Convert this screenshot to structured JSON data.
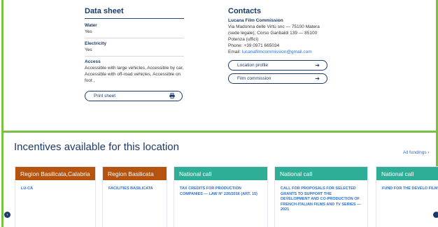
{
  "datasheet": {
    "title": "Data sheet",
    "fields": [
      {
        "label": "Water",
        "value": "Yes"
      },
      {
        "label": "Electricity",
        "value": "Yes"
      },
      {
        "label": "Access",
        "value": "Accessible with large vehicles, Accessible by car, Accessible with off-road vehicles, Accessible on foot ,"
      }
    ],
    "print_label": "Print sheet",
    "print_icon": "printer-icon"
  },
  "contacts": {
    "title": "Contacts",
    "org": "Lucana Film Commission",
    "lines": [
      "Via Madonna delle Virtù snc — 75100 Matera",
      "(sede legale); Corso Garibaldi 139 — 85100",
      "Potenza (uffici)",
      "Phone: +39 0971 665034"
    ],
    "email_prefix": "Email: ",
    "email": "lucanafilmcommission@gmail.com",
    "buttons": [
      {
        "label": "Location profile",
        "icon": "arrow-right-icon"
      },
      {
        "label": "Film commission",
        "icon": "arrow-right-icon"
      }
    ]
  },
  "incentives": {
    "title": "Incentives available for this location",
    "all_fundings": "All fundings",
    "all_fundings_icon": "chevron-right-icon",
    "cards": [
      {
        "head": "Region Basilicata,Calabria",
        "body": "LU-CA",
        "color": "#b5530f"
      },
      {
        "head": "Region Basilicata",
        "body": "FACILITIES BASILICATA",
        "color": "#b5530f"
      },
      {
        "head": "National call",
        "body": "TAX CREDITS FOR PRODUCTION COMPANIES — LAW N° 220/2016 (ART. 15)",
        "color": "#2eae96"
      },
      {
        "head": "National call",
        "body": "CALL FOR PROPOSALS FOR SELECTED GRANTS TO SUPPORT THE DEVELOPMENT AND CO-PRODUCTION OF FRENCH-ITALIAN FILMS AND TV SERIES — 2021",
        "color": "#2eae96"
      },
      {
        "head": "National call",
        "body": "FUND FOR THE DEVELO FILM CO-PRODUCTIONS CHILE AND ITALY",
        "color": "#2eae96"
      }
    ]
  },
  "colors": {
    "accent_green": "#7ac143",
    "navy": "#1b3a6b",
    "link_blue": "#2a6fd6"
  }
}
